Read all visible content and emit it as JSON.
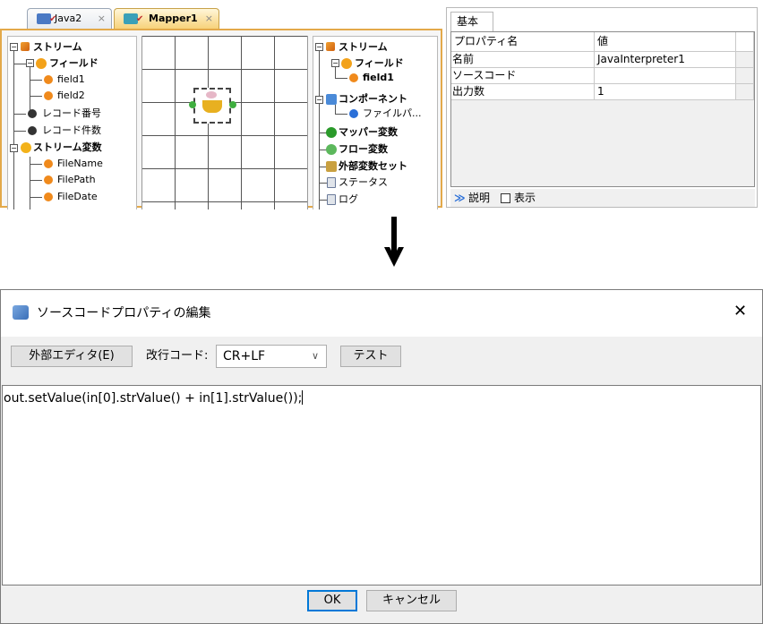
{
  "tabs": [
    {
      "label": "Java2"
    },
    {
      "label": "Mapper1"
    }
  ],
  "close_glyph": "×",
  "left_tree": {
    "items": [
      {
        "label": "ストリーム",
        "icon": "stream-icon"
      },
      {
        "label": "フィールド",
        "icon": "field-group-icon"
      },
      {
        "label": "field1",
        "icon": "field-icon"
      },
      {
        "label": "field2",
        "icon": "field-icon"
      },
      {
        "label": "レコード番号",
        "icon": "black-dot-icon"
      },
      {
        "label": "レコード件数",
        "icon": "black-dot-icon"
      },
      {
        "label": "ストリーム変数",
        "icon": "variable-group-icon"
      },
      {
        "label": "FileName",
        "icon": "field-icon"
      },
      {
        "label": "FilePath",
        "icon": "field-icon"
      },
      {
        "label": "FileDate",
        "icon": "field-icon"
      }
    ]
  },
  "right_tree": {
    "items": [
      {
        "label": "ストリーム"
      },
      {
        "label": "フィールド"
      },
      {
        "label": "field1"
      },
      {
        "label": "コンポーネント"
      },
      {
        "label": "ファイルパ..."
      },
      {
        "label": "マッパー変数"
      },
      {
        "label": "フロー変数"
      },
      {
        "label": "外部変数セット"
      },
      {
        "label": "ステータス"
      },
      {
        "label": "ログ"
      }
    ]
  },
  "properties": {
    "tab_label": "基本",
    "header": {
      "name": "プロパティ名",
      "value": "値"
    },
    "rows": [
      {
        "name": "名前",
        "value": "JavaInterpreter1"
      },
      {
        "name": "ソースコード",
        "value": ""
      },
      {
        "name": "出力数",
        "value": "1"
      }
    ],
    "description_label": "説明",
    "show_label": "表示"
  },
  "dialog": {
    "title": "ソースコードプロパティの編集",
    "close_glyph": "✕",
    "external_editor_label": "外部エディタ(E)",
    "newline_label": "改行コード:",
    "newline_value": "CR+LF",
    "test_label": "テスト",
    "code": "out.setValue(in[0].strValue() + in[1].strValue());",
    "ok_label": "OK",
    "cancel_label": "キャンセル"
  },
  "colors": {
    "active_tab": "#f7d27a",
    "frame_border": "#e3a94a",
    "field_orange": "#f08a1c",
    "check_red": "#c03030"
  }
}
